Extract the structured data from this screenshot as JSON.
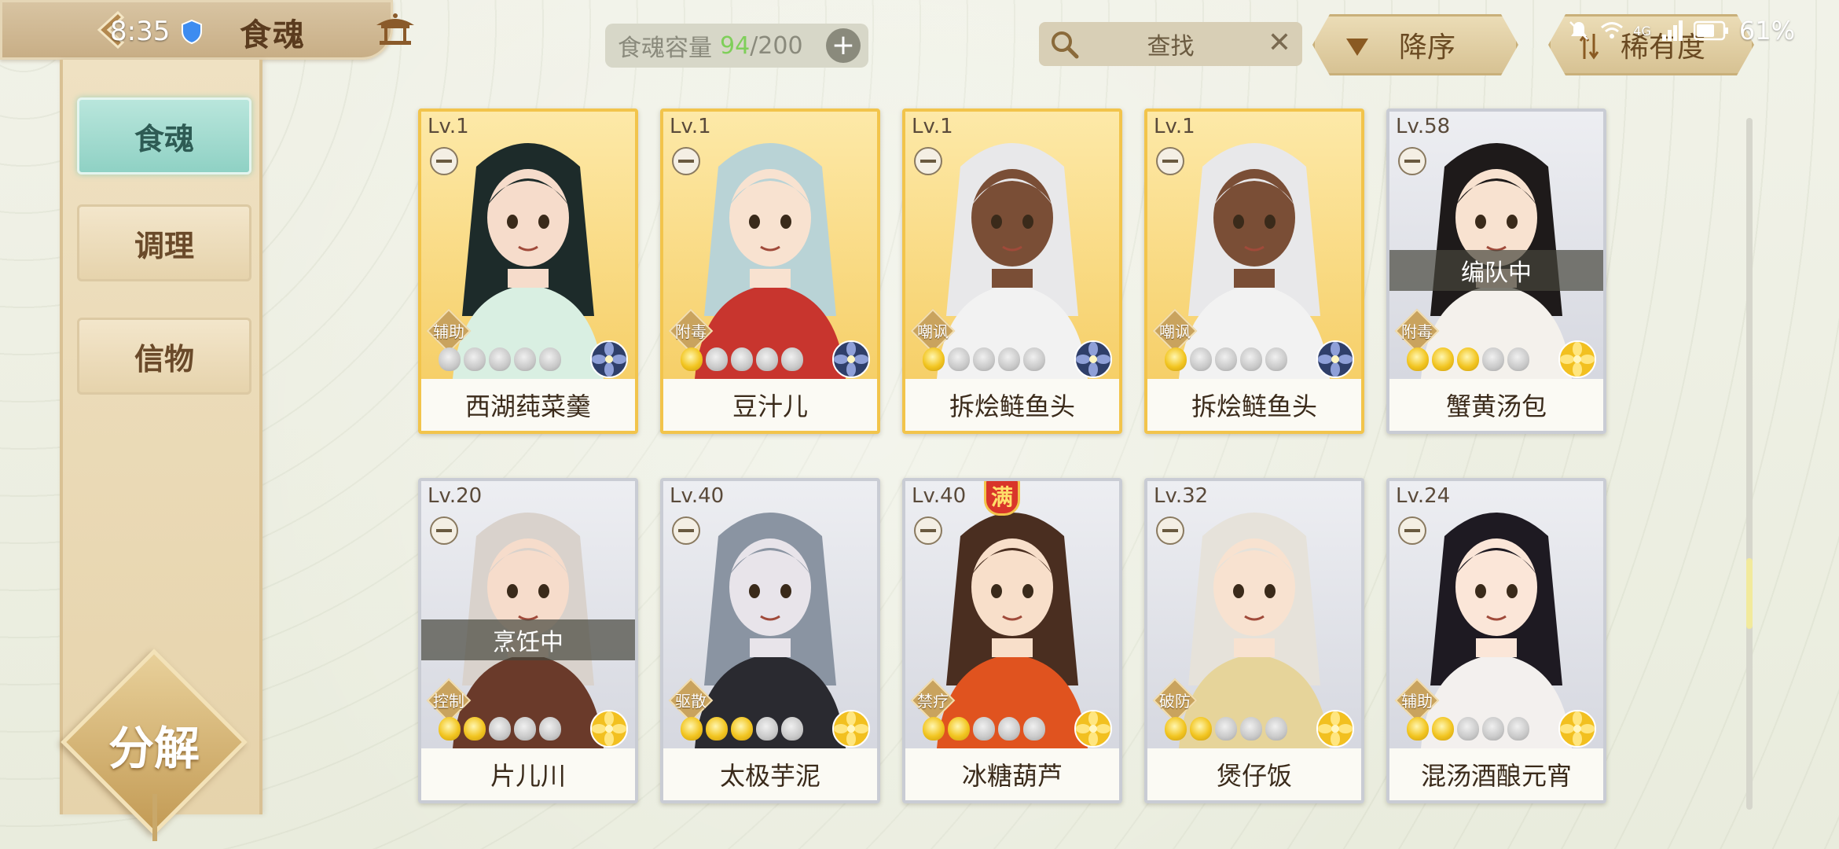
{
  "status": {
    "time": "8:35",
    "battery": "61%",
    "network": "4G"
  },
  "header": {
    "title": "食魂",
    "capacity_label": "食魂容量",
    "capacity_current": "94",
    "capacity_max": "/200",
    "search_placeholder": "查找",
    "sort_order": "降序",
    "sort_key": "稀有度"
  },
  "sidebar": {
    "tabs": [
      {
        "label": "食魂",
        "active": true
      },
      {
        "label": "调理",
        "active": false
      },
      {
        "label": "信物",
        "active": false
      }
    ],
    "decompose_label": "分解"
  },
  "cards": [
    {
      "level": "Lv.1",
      "name": "西湖莼菜羹",
      "role": "辅助",
      "rarity": "gold",
      "stars": 0,
      "element": "blue",
      "busy": "",
      "full": ""
    },
    {
      "level": "Lv.1",
      "name": "豆汁儿",
      "role": "附毒",
      "rarity": "gold",
      "stars": 1,
      "element": "blue",
      "busy": "",
      "full": ""
    },
    {
      "level": "Lv.1",
      "name": "拆烩鲢鱼头",
      "role": "嘲讽",
      "rarity": "gold",
      "stars": 1,
      "element": "blue",
      "busy": "",
      "full": ""
    },
    {
      "level": "Lv.1",
      "name": "拆烩鲢鱼头",
      "role": "嘲讽",
      "rarity": "gold",
      "stars": 1,
      "element": "blue",
      "busy": "",
      "full": ""
    },
    {
      "level": "Lv.58",
      "name": "蟹黄汤包",
      "role": "附毒",
      "rarity": "silver",
      "stars": 3,
      "element": "gold",
      "busy": "编队中",
      "full": ""
    },
    {
      "level": "Lv.20",
      "name": "片儿川",
      "role": "控制",
      "rarity": "silver",
      "stars": 2,
      "element": "gold",
      "busy": "烹饪中",
      "full": ""
    },
    {
      "level": "Lv.40",
      "name": "太极芋泥",
      "role": "驱散",
      "rarity": "silver",
      "stars": 3,
      "element": "gold",
      "busy": "",
      "full": ""
    },
    {
      "level": "Lv.40",
      "name": "冰糖葫芦",
      "role": "禁疗",
      "rarity": "silver",
      "stars": 2,
      "element": "gold",
      "busy": "",
      "full": "满"
    },
    {
      "level": "Lv.32",
      "name": "煲仔饭",
      "role": "破防",
      "rarity": "silver",
      "stars": 2,
      "element": "gold",
      "busy": "",
      "full": ""
    },
    {
      "level": "Lv.24",
      "name": "混汤酒酿元宵",
      "role": "辅助",
      "rarity": "silver",
      "stars": 2,
      "element": "gold",
      "busy": "",
      "full": ""
    }
  ],
  "colors": {
    "gold_frame": "#f2c44b",
    "silver_frame": "#c9ccd4",
    "active_tab": "#8fd1c4",
    "capacity_current": "#7fcf5a"
  }
}
